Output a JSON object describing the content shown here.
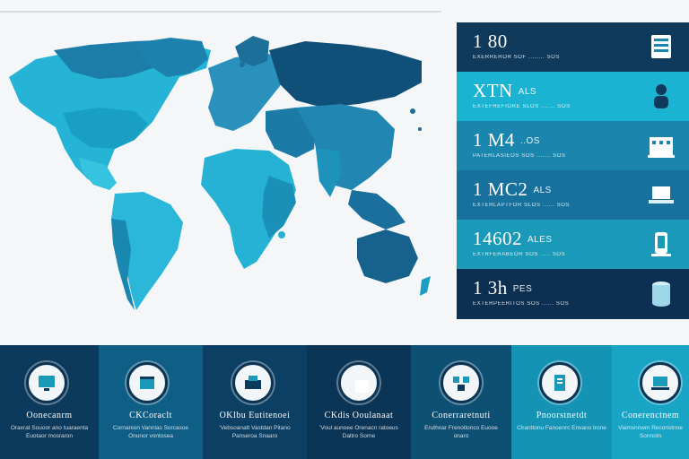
{
  "stats": [
    {
      "value": "1 80",
      "unit": "",
      "caption": "EXERREROR SOF   ........ SOS",
      "bg": "#0f3a5c",
      "icon": "server-icon"
    },
    {
      "value": "XTN",
      "unit": "ALS",
      "caption": "EXTEFREFIORE SLOS   ....... SOS",
      "bg": "#1ab4d2",
      "icon": "person-icon"
    },
    {
      "value": "1 M4",
      "unit": "..OS",
      "caption": "PATERLASIEOS SOS   ....... SOS",
      "bg": "#1b86ad",
      "icon": "building-icon"
    },
    {
      "value": "1 MC2",
      "unit": "ALS",
      "caption": "EXTERLAPTFOR SLOS   ...... SOS",
      "bg": "#17719c",
      "icon": "laptop-icon"
    },
    {
      "value": "14602",
      "unit": "ALES",
      "caption": "EXTRFERABEOR SOS   ..... SOS",
      "bg": "#1a9ab8",
      "icon": "phone-icon"
    },
    {
      "value": "1 3h",
      "unit": "PES",
      "caption": "EXTERPEERITOS SOS   ...... SOS",
      "bg": "#0d2f52",
      "icon": "database-icon"
    }
  ],
  "tiles": [
    {
      "title": "Oonecanrm",
      "desc": "Oraxrat Souoor ano tuaraenta Euotaor mosraron",
      "bg": "#0b3a5c",
      "icon": "monitor-icon"
    },
    {
      "title": "CKCoraclt",
      "desc": "Cornanion Vannlas Sorcasoe Onunor vontosea",
      "bg": "#0f5e86",
      "icon": "box-icon"
    },
    {
      "title": "OKlbu Eutitenoei",
      "desc": "'Vebsoanatt Vastdan Pitano Panseroa Snaaro",
      "bg": "#0c3f64",
      "icon": "printer-icon"
    },
    {
      "title": "CKdis Ooulanaat",
      "desc": "'Voul aunoee Orenacn ratoeus Daltro Sorne",
      "bg": "#0b3556",
      "icon": "laptop-icon"
    },
    {
      "title": "Conerraretnuti",
      "desc": "Eruthnar Frenotlonco Euooe onaro",
      "bg": "#0e4f74",
      "icon": "network-icon"
    },
    {
      "title": "Pnoorstnetdt",
      "desc": "Clranttonu Fanoenrc Envano trone",
      "bg": "#1593b5",
      "icon": "document-icon"
    },
    {
      "title": "Conerenctnem",
      "desc": "Viamsnnwm Reconstnne Sonnotn",
      "bg": "#18a4c4",
      "icon": "computer-icon"
    }
  ]
}
